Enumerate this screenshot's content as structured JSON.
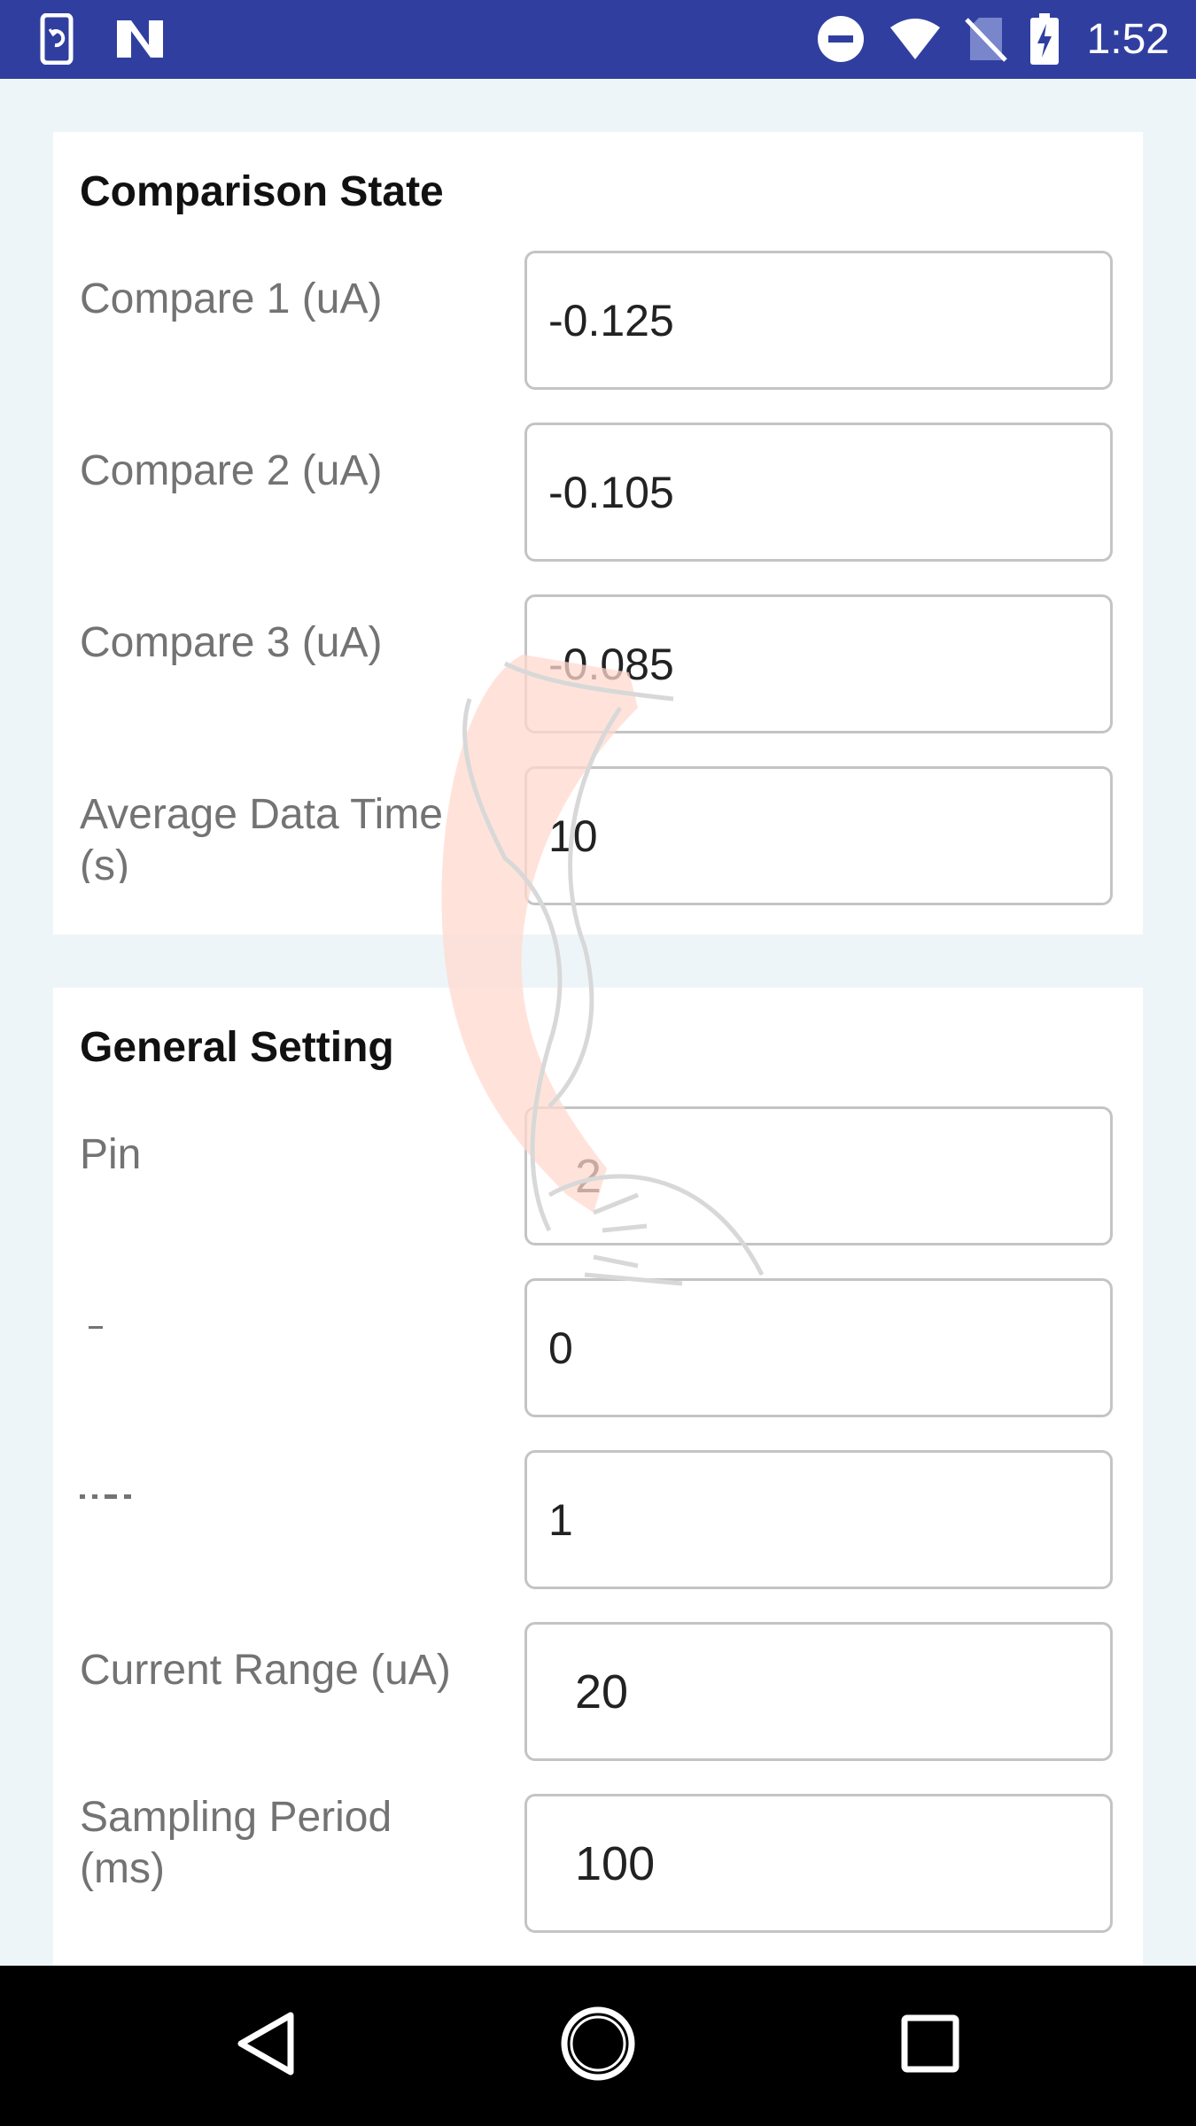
{
  "status_bar": {
    "time": "1:52",
    "icons": [
      "phone-sync-icon",
      "n-logo-icon",
      "do-not-disturb-icon",
      "wifi-icon",
      "no-sim-icon",
      "battery-charging-icon"
    ]
  },
  "comparison": {
    "title": "Comparison State",
    "rows": [
      {
        "label": "Compare 1 (uA)",
        "value": "-0.125"
      },
      {
        "label": "Compare 2 (uA)",
        "value": "-0.105"
      },
      {
        "label": "Compare 3 (uA)",
        "value": "-0.085"
      },
      {
        "label": "Average Data Time (s)",
        "value": "10"
      }
    ]
  },
  "general": {
    "title": "General Setting",
    "rows": [
      {
        "label": "Pin",
        "value": "2"
      },
      {
        "label": "",
        "value": "0"
      },
      {
        "label": "",
        "value": "1"
      },
      {
        "label": "Current Range (uA)",
        "value": "20"
      },
      {
        "label": "Sampling Period (ms)",
        "value": "100"
      }
    ]
  },
  "nav_bar": {
    "icons": [
      "back-icon",
      "home-icon",
      "recents-icon"
    ]
  }
}
